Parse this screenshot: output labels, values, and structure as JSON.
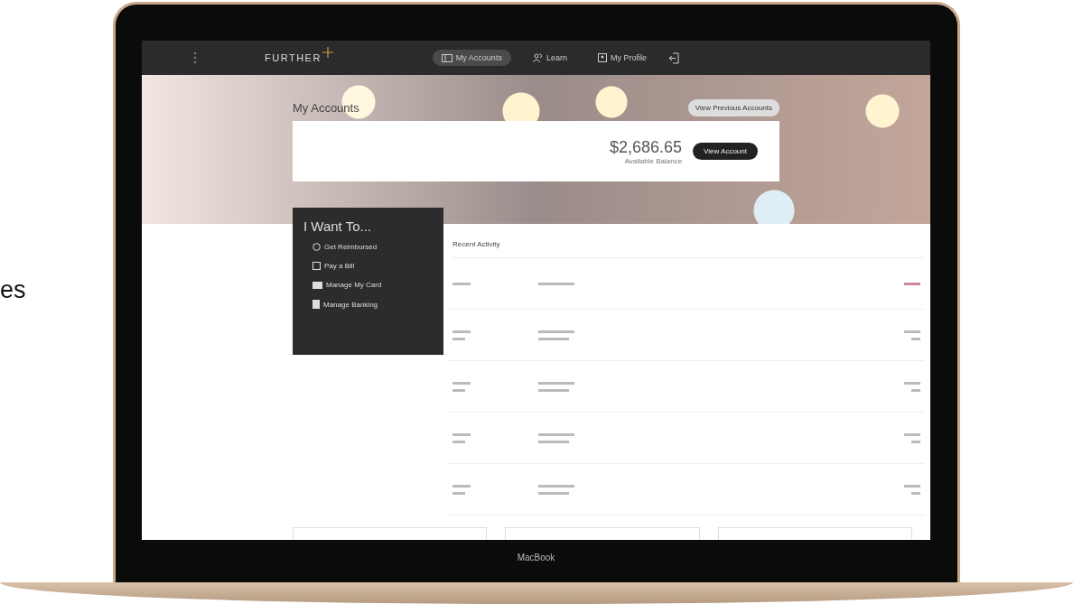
{
  "side_text": "es",
  "nav": {
    "logo": "FURTHER",
    "items": [
      {
        "label": "My Accounts",
        "selected": true
      },
      {
        "label": "Learn",
        "selected": false
      },
      {
        "label": "My Profile",
        "selected": false
      }
    ]
  },
  "hero": {
    "title": "My Accounts",
    "previous_button": "View Previous Accounts",
    "balance": "$2,686.65",
    "balance_label": "Available Balance",
    "view_button": "View Account"
  },
  "i_want_to": {
    "title": "I Want To...",
    "items": [
      {
        "label": "Get Reimbursed"
      },
      {
        "label": "Pay a Bill"
      },
      {
        "label": "Manage My Card"
      },
      {
        "label": "Manage Banking"
      }
    ]
  },
  "recent_activity": {
    "title": "Recent Activity",
    "rows": [
      {
        "kind": "pending",
        "negative": true
      },
      {
        "kind": "posted",
        "negative": false
      },
      {
        "kind": "posted",
        "negative": false
      },
      {
        "kind": "posted",
        "negative": false
      },
      {
        "kind": "posted",
        "negative": false
      }
    ]
  },
  "laptop_label": "MacBook"
}
